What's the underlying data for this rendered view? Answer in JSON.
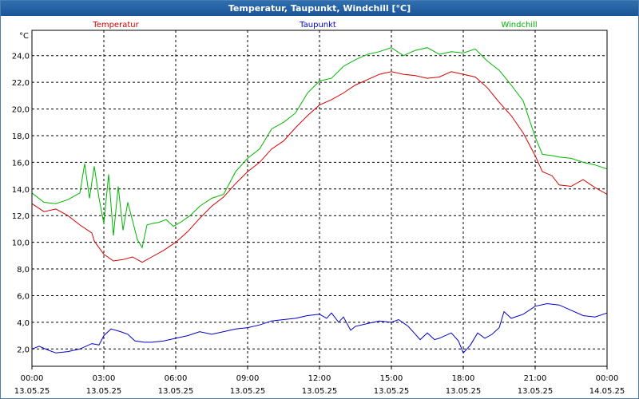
{
  "window": {
    "title": "Temperatur, Taupunkt, Windchill [°C]"
  },
  "chart_data": {
    "type": "line",
    "title": "Temperatur, Taupunkt, Windchill [°C]",
    "ylabel": "°C",
    "ylim": [
      0.7,
      25.9
    ],
    "xlim": [
      0,
      24
    ],
    "grid": true,
    "legend_placement": "top",
    "y_ticks": [
      "2,0",
      "4,0",
      "6,0",
      "8,0",
      "10,0",
      "12,0",
      "14,0",
      "16,0",
      "18,0",
      "20,0",
      "22,0",
      "24,0"
    ],
    "x_ticks": [
      {
        "time": "00:00",
        "date": "13.05.25"
      },
      {
        "time": "03:00",
        "date": "13.05.25"
      },
      {
        "time": "06:00",
        "date": "13.05.25"
      },
      {
        "time": "09:00",
        "date": "13.05.25"
      },
      {
        "time": "12:00",
        "date": "13.05.25"
      },
      {
        "time": "15:00",
        "date": "13.05.25"
      },
      {
        "time": "18:00",
        "date": "13.05.25"
      },
      {
        "time": "21:00",
        "date": "13.05.25"
      },
      {
        "time": "00:00",
        "date": "14.05.25"
      }
    ],
    "series": [
      {
        "name": "Temperatur",
        "color": "#d40000",
        "points": [
          [
            0,
            12.9
          ],
          [
            0.5,
            12.3
          ],
          [
            1,
            12.5
          ],
          [
            1.5,
            12.0
          ],
          [
            2,
            11.3
          ],
          [
            2.5,
            10.7
          ],
          [
            2.6,
            10.1
          ],
          [
            3,
            9.1
          ],
          [
            3.4,
            8.6
          ],
          [
            3.8,
            8.7
          ],
          [
            4.2,
            8.9
          ],
          [
            4.6,
            8.5
          ],
          [
            5,
            8.9
          ],
          [
            5.5,
            9.4
          ],
          [
            6,
            10.0
          ],
          [
            6.5,
            10.8
          ],
          [
            7,
            11.8
          ],
          [
            7.5,
            12.7
          ],
          [
            8,
            13.4
          ],
          [
            8.5,
            14.4
          ],
          [
            9,
            15.3
          ],
          [
            9.5,
            16.0
          ],
          [
            10,
            17.0
          ],
          [
            10.5,
            17.6
          ],
          [
            11,
            18.6
          ],
          [
            11.5,
            19.5
          ],
          [
            12,
            20.3
          ],
          [
            12.5,
            20.7
          ],
          [
            13,
            21.2
          ],
          [
            13.5,
            21.8
          ],
          [
            14,
            22.2
          ],
          [
            14.5,
            22.6
          ],
          [
            15,
            22.8
          ],
          [
            15.5,
            22.6
          ],
          [
            16,
            22.5
          ],
          [
            16.5,
            22.3
          ],
          [
            17,
            22.4
          ],
          [
            17.5,
            22.8
          ],
          [
            18,
            22.6
          ],
          [
            18.5,
            22.4
          ],
          [
            19,
            21.6
          ],
          [
            19.5,
            20.5
          ],
          [
            20,
            19.5
          ],
          [
            20.5,
            18.2
          ],
          [
            21,
            16.5
          ],
          [
            21.3,
            15.3
          ],
          [
            21.7,
            15.0
          ],
          [
            22,
            14.3
          ],
          [
            22.5,
            14.2
          ],
          [
            23,
            14.7
          ],
          [
            23.5,
            14.1
          ],
          [
            24,
            13.6
          ]
        ]
      },
      {
        "name": "Taupunkt",
        "color": "#0000c8",
        "points": [
          [
            0,
            2.0
          ],
          [
            0.3,
            2.2
          ],
          [
            0.7,
            1.9
          ],
          [
            1,
            1.7
          ],
          [
            1.5,
            1.8
          ],
          [
            2,
            2.0
          ],
          [
            2.5,
            2.4
          ],
          [
            2.8,
            2.3
          ],
          [
            3,
            3.0
          ],
          [
            3.3,
            3.5
          ],
          [
            3.7,
            3.3
          ],
          [
            4,
            3.1
          ],
          [
            4.3,
            2.6
          ],
          [
            4.7,
            2.5
          ],
          [
            5,
            2.5
          ],
          [
            5.5,
            2.6
          ],
          [
            6,
            2.8
          ],
          [
            6.5,
            3.0
          ],
          [
            7,
            3.3
          ],
          [
            7.5,
            3.1
          ],
          [
            8,
            3.3
          ],
          [
            8.5,
            3.5
          ],
          [
            9,
            3.6
          ],
          [
            9.5,
            3.8
          ],
          [
            10,
            4.1
          ],
          [
            10.5,
            4.2
          ],
          [
            11,
            4.3
          ],
          [
            11.5,
            4.5
          ],
          [
            12,
            4.6
          ],
          [
            12.3,
            4.3
          ],
          [
            12.5,
            4.7
          ],
          [
            12.8,
            4.0
          ],
          [
            13,
            4.4
          ],
          [
            13.3,
            3.4
          ],
          [
            13.5,
            3.7
          ],
          [
            14,
            3.9
          ],
          [
            14.5,
            4.1
          ],
          [
            15,
            4.0
          ],
          [
            15.3,
            4.2
          ],
          [
            15.7,
            3.7
          ],
          [
            16,
            3.1
          ],
          [
            16.2,
            2.7
          ],
          [
            16.5,
            3.2
          ],
          [
            16.8,
            2.7
          ],
          [
            17,
            2.8
          ],
          [
            17.5,
            3.2
          ],
          [
            17.8,
            2.6
          ],
          [
            18,
            1.7
          ],
          [
            18.3,
            2.3
          ],
          [
            18.6,
            3.2
          ],
          [
            18.9,
            2.8
          ],
          [
            19.2,
            3.1
          ],
          [
            19.5,
            3.6
          ],
          [
            19.7,
            4.8
          ],
          [
            20,
            4.3
          ],
          [
            20.5,
            4.6
          ],
          [
            21,
            5.2
          ],
          [
            21.5,
            5.4
          ],
          [
            22,
            5.3
          ],
          [
            22.5,
            4.9
          ],
          [
            23,
            4.5
          ],
          [
            23.5,
            4.4
          ],
          [
            24,
            4.7
          ]
        ]
      },
      {
        "name": "Windchill",
        "color": "#00b400",
        "points": [
          [
            0,
            13.7
          ],
          [
            0.5,
            13.0
          ],
          [
            1,
            12.9
          ],
          [
            1.5,
            13.2
          ],
          [
            2,
            13.7
          ],
          [
            2.2,
            15.9
          ],
          [
            2.4,
            13.3
          ],
          [
            2.6,
            15.7
          ],
          [
            2.8,
            13.3
          ],
          [
            3,
            11.4
          ],
          [
            3.2,
            15.1
          ],
          [
            3.4,
            10.5
          ],
          [
            3.6,
            14.2
          ],
          [
            3.8,
            10.9
          ],
          [
            4,
            13.0
          ],
          [
            4.4,
            10.2
          ],
          [
            4.6,
            9.6
          ],
          [
            4.8,
            11.3
          ],
          [
            5,
            11.4
          ],
          [
            5.3,
            11.5
          ],
          [
            5.6,
            11.7
          ],
          [
            5.9,
            11.2
          ],
          [
            6.2,
            11.5
          ],
          [
            6.6,
            12.0
          ],
          [
            7,
            12.7
          ],
          [
            7.5,
            13.3
          ],
          [
            8,
            13.6
          ],
          [
            8.5,
            15.3
          ],
          [
            9,
            16.3
          ],
          [
            9.5,
            17.0
          ],
          [
            10,
            18.5
          ],
          [
            10.5,
            19.0
          ],
          [
            11,
            19.7
          ],
          [
            11.5,
            21.2
          ],
          [
            12,
            22.1
          ],
          [
            12.5,
            22.3
          ],
          [
            13,
            23.2
          ],
          [
            13.5,
            23.7
          ],
          [
            14,
            24.1
          ],
          [
            14.5,
            24.3
          ],
          [
            15,
            24.6
          ],
          [
            15.5,
            24.0
          ],
          [
            16,
            24.4
          ],
          [
            16.5,
            24.6
          ],
          [
            17,
            24.1
          ],
          [
            17.5,
            24.3
          ],
          [
            18,
            24.2
          ],
          [
            18.5,
            24.5
          ],
          [
            19,
            23.6
          ],
          [
            19.5,
            22.9
          ],
          [
            20,
            21.8
          ],
          [
            20.5,
            20.6
          ],
          [
            21,
            17.9
          ],
          [
            21.3,
            16.6
          ],
          [
            21.7,
            16.5
          ],
          [
            22,
            16.4
          ],
          [
            22.5,
            16.3
          ],
          [
            23,
            16.0
          ],
          [
            23.5,
            15.8
          ],
          [
            24,
            15.5
          ]
        ]
      }
    ]
  }
}
